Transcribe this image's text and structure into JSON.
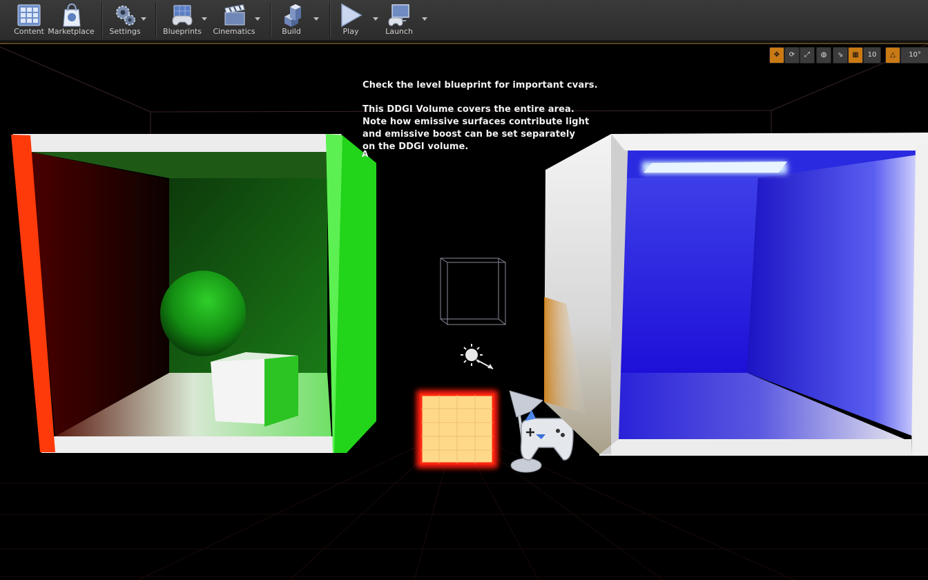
{
  "toolbar": {
    "items": [
      {
        "label": "Content",
        "icon": "content-grid-icon"
      },
      {
        "label": "Marketplace",
        "icon": "marketplace-bag-icon"
      },
      {
        "label": "Settings",
        "icon": "settings-gears-icon"
      },
      {
        "label": "Blueprints",
        "icon": "blueprints-gamepad-icon"
      },
      {
        "label": "Cinematics",
        "icon": "cinematics-clapper-icon"
      },
      {
        "label": "Build",
        "icon": "build-blocks-icon"
      },
      {
        "label": "Play",
        "icon": "play-icon"
      },
      {
        "label": "Launch",
        "icon": "launch-monitor-icon"
      }
    ]
  },
  "viewport": {
    "controls": {
      "grid_snap_value": "10",
      "rotation_snap_value": "10°"
    },
    "overlay_text": {
      "line1": "Check the level blueprint for important cvars.",
      "line2": "This DDGI Volume covers the entire area.",
      "line3": "Note how emissive surfaces contribute light",
      "line4": "and emissive boost can be set separately",
      "line5": "on the DDGI volume.",
      "marker": "A"
    }
  },
  "colors": {
    "toolbar_bg": "#333333",
    "accent_orange": "#c97a14",
    "left_room_red": "#ff3a0a",
    "left_room_green": "#22d41a",
    "right_room_blue": "#2a1fe0",
    "emissive_panel": "#ffd98a"
  }
}
